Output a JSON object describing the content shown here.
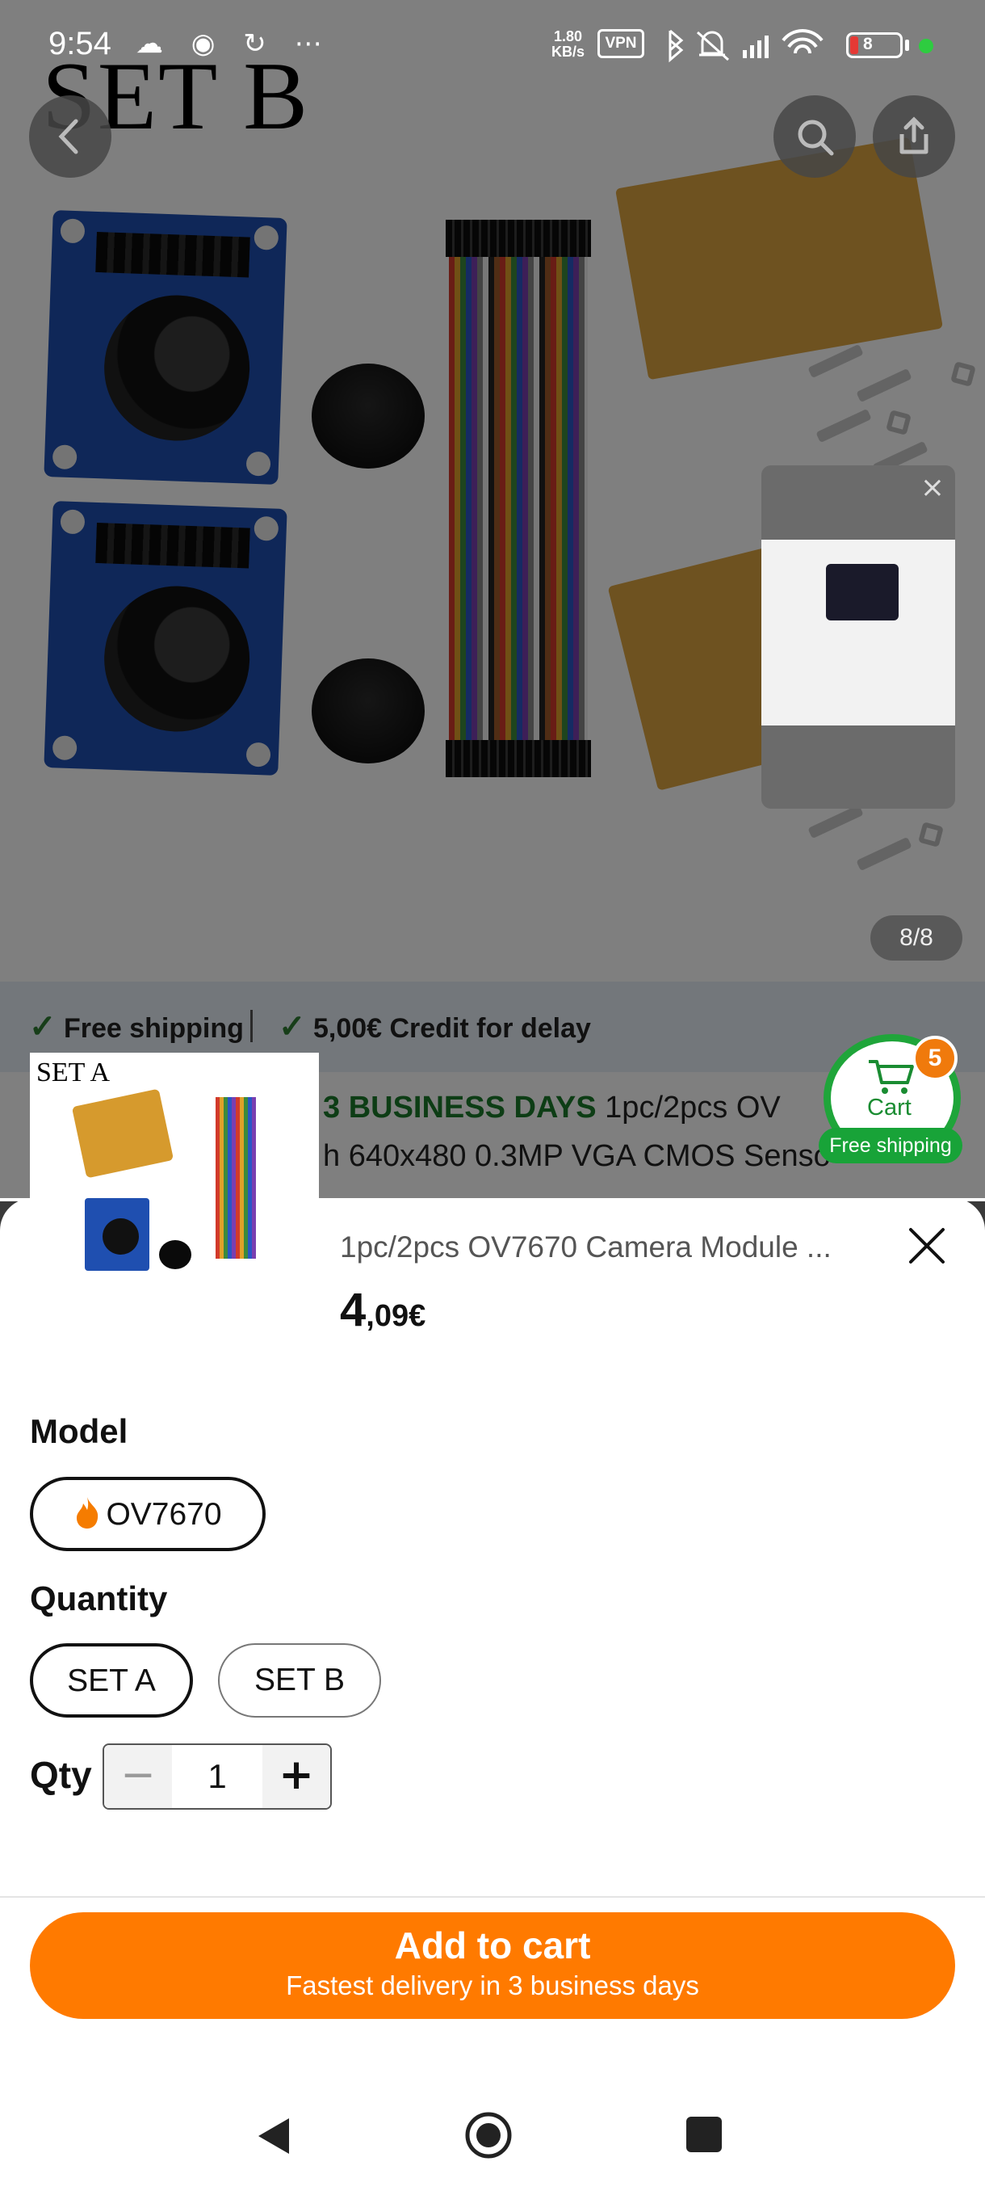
{
  "status_bar": {
    "time": "9:54",
    "icons_left": [
      "cloud-icon",
      "sync-icon",
      "refresh-icon",
      "more-icon"
    ],
    "net_speed_value": "1.80",
    "net_speed_unit": "KB/s",
    "vpn": "VPN",
    "icons_right": [
      "bluetooth-icon",
      "mute-icon",
      "signal-icon",
      "wifi-icon"
    ],
    "battery": "8"
  },
  "product_image": {
    "caption": "SET B",
    "page_counter": "8/8"
  },
  "shipping": {
    "free_shipping": "Free shipping",
    "credit": "5,00€ Credit for delay"
  },
  "listing": {
    "delivery_badge": "3 BUSINESS DAYS",
    "title_part1": "1pc/2pcs OV",
    "title_part2": "h 640x480 0.3MP VGA CMOS Senso"
  },
  "preview": {
    "label": "SET A"
  },
  "cart": {
    "label": "Cart",
    "count": "5",
    "free_shipping": "Free shipping",
    "accent": "#1fa53a"
  },
  "sheet": {
    "title": "1pc/2pcs OV7670 Camera Module ...",
    "price_int": "4",
    "price_dec": ",09€",
    "model_label": "Model",
    "model_options": [
      "OV7670"
    ],
    "quantity_label": "Quantity",
    "quantity_options": [
      "SET A",
      "SET B"
    ],
    "selected_quantity": "SET A",
    "qty_label": "Qty",
    "qty_value": "1",
    "add_to_cart": "Add to cart",
    "add_to_cart_sub": "Fastest delivery in 3 business days",
    "accent": "#ff7a00"
  }
}
